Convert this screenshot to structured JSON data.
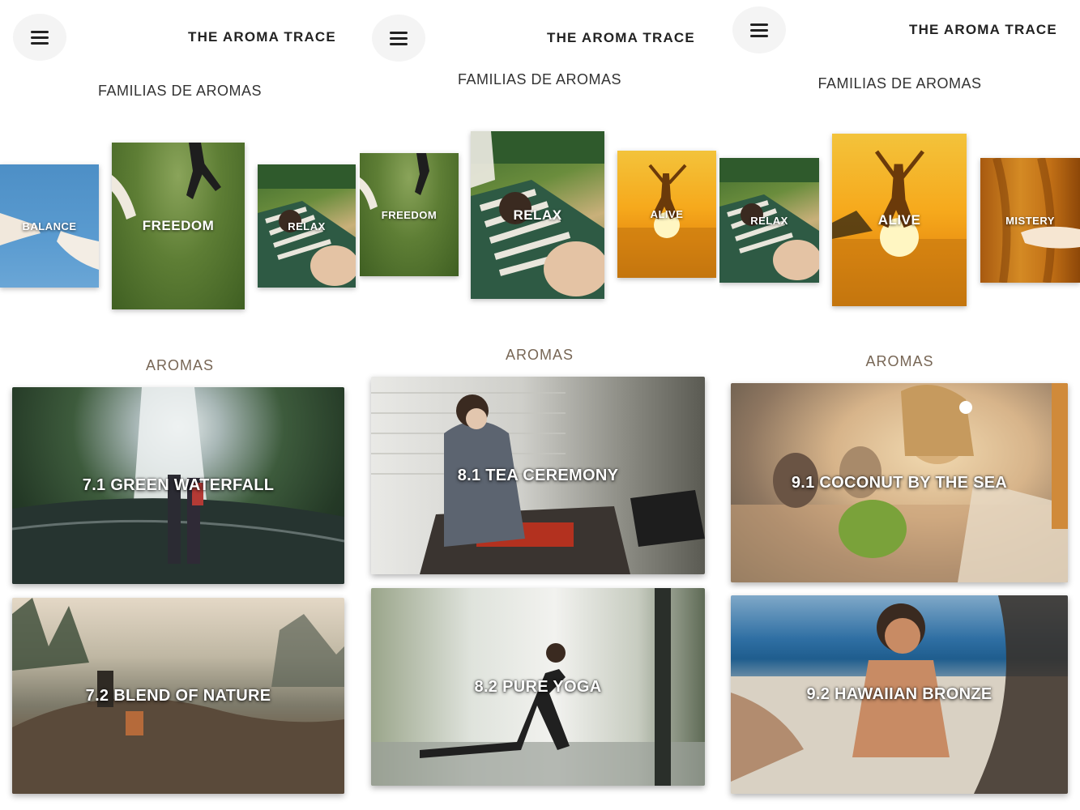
{
  "screens": [
    {
      "brand": "THE AROMA TRACE",
      "families_title": "FAMILIAS DE AROMAS",
      "aromas_title": "AROMAS",
      "families": [
        {
          "label": "BALANCE",
          "icon": "balance-image"
        },
        {
          "label": "FREEDOM",
          "icon": "freedom-image"
        },
        {
          "label": "RELAX",
          "icon": "relax-image"
        }
      ],
      "aromas": [
        {
          "label": "7.1 GREEN WATERFALL",
          "icon": "waterfall-image"
        },
        {
          "label": "7.2 BLEND OF NATURE",
          "icon": "nature-image"
        }
      ]
    },
    {
      "brand": "THE AROMA TRACE",
      "families_title": "FAMILIAS DE AROMAS",
      "aromas_title": "AROMAS",
      "families": [
        {
          "label": "FREEDOM",
          "icon": "freedom-image"
        },
        {
          "label": "RELAX",
          "icon": "relax-image"
        },
        {
          "label": "ALIVE",
          "icon": "alive-image"
        }
      ],
      "aromas": [
        {
          "label": "8.1 TEA CEREMONY",
          "icon": "tea-image"
        },
        {
          "label": "8.2 PURE YOGA",
          "icon": "yoga-image"
        }
      ]
    },
    {
      "brand": "THE AROMA TRACE",
      "families_title": "FAMILIAS DE AROMAS",
      "aromas_title": "AROMAS",
      "families": [
        {
          "label": "RELAX",
          "icon": "relax-image"
        },
        {
          "label": "ALIVE",
          "icon": "alive-image"
        },
        {
          "label": "MISTERY",
          "icon": "mistery-image"
        }
      ],
      "aromas": [
        {
          "label": "9.1 COCONUT BY THE SEA",
          "icon": "coconut-image"
        },
        {
          "label": "9.2 HAWAIIAN BRONZE",
          "icon": "hawaii-image"
        }
      ]
    }
  ],
  "colors": {
    "text": "#222222",
    "aromas_heading": "#776655",
    "menu_button_bg": "#f4f4f4"
  }
}
